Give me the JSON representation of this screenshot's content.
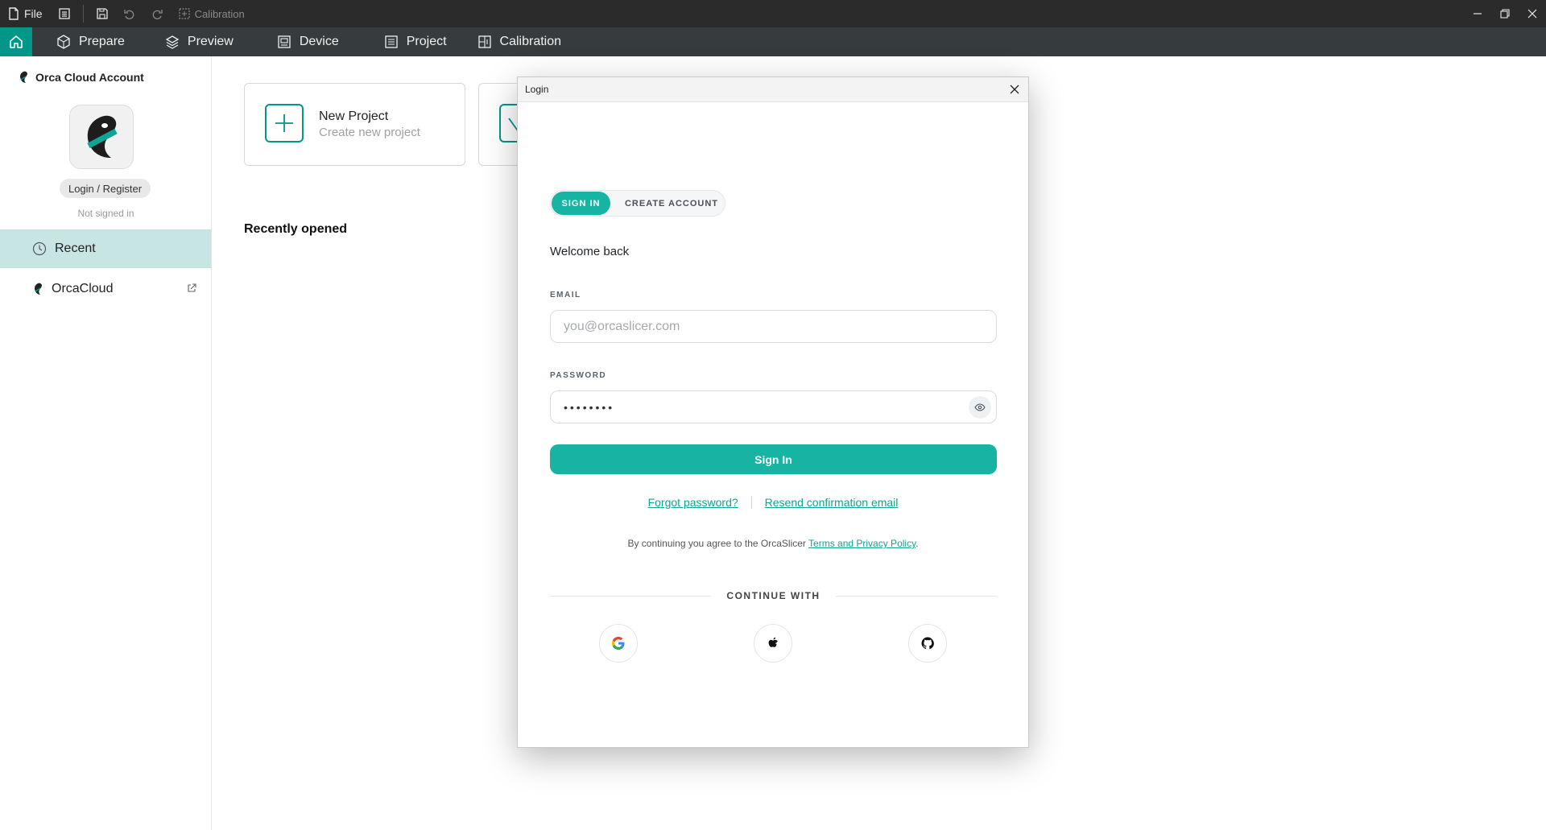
{
  "titlebar": {
    "file_label": "File",
    "calibration_label": "Calibration"
  },
  "tabs": [
    {
      "label": "Prepare"
    },
    {
      "label": "Preview"
    },
    {
      "label": "Device"
    },
    {
      "label": "Project"
    },
    {
      "label": "Calibration"
    }
  ],
  "sidebar": {
    "account_title": "Orca Cloud Account",
    "login_register": "Login / Register",
    "status": "Not signed in",
    "items": [
      {
        "label": "Recent",
        "active": true
      },
      {
        "label": "OrcaCloud",
        "active": false
      }
    ]
  },
  "main": {
    "new_project_title": "New Project",
    "new_project_sub": "Create new project",
    "recent_title": "Recently opened"
  },
  "dialog": {
    "title": "Login",
    "tab_signin": "SIGN IN",
    "tab_create": "CREATE ACCOUNT",
    "welcome": "Welcome back",
    "email_label": "EMAIL",
    "email_placeholder": "you@orcaslicer.com",
    "password_label": "PASSWORD",
    "password_value": "••••••••",
    "signin_button": "Sign In",
    "forgot": "Forgot password?",
    "resend": "Resend confirmation email",
    "terms_prefix": "By continuing you agree to the OrcaSlicer ",
    "terms_link": "Terms and Privacy Policy",
    "terms_suffix": ".",
    "continue_with": "CONTINUE WITH"
  },
  "colors": {
    "accent": "#009688",
    "button": "#17b3a3",
    "link": "#12a293",
    "titlebar": "#2b2b2b",
    "tabbar": "#363c3e"
  }
}
